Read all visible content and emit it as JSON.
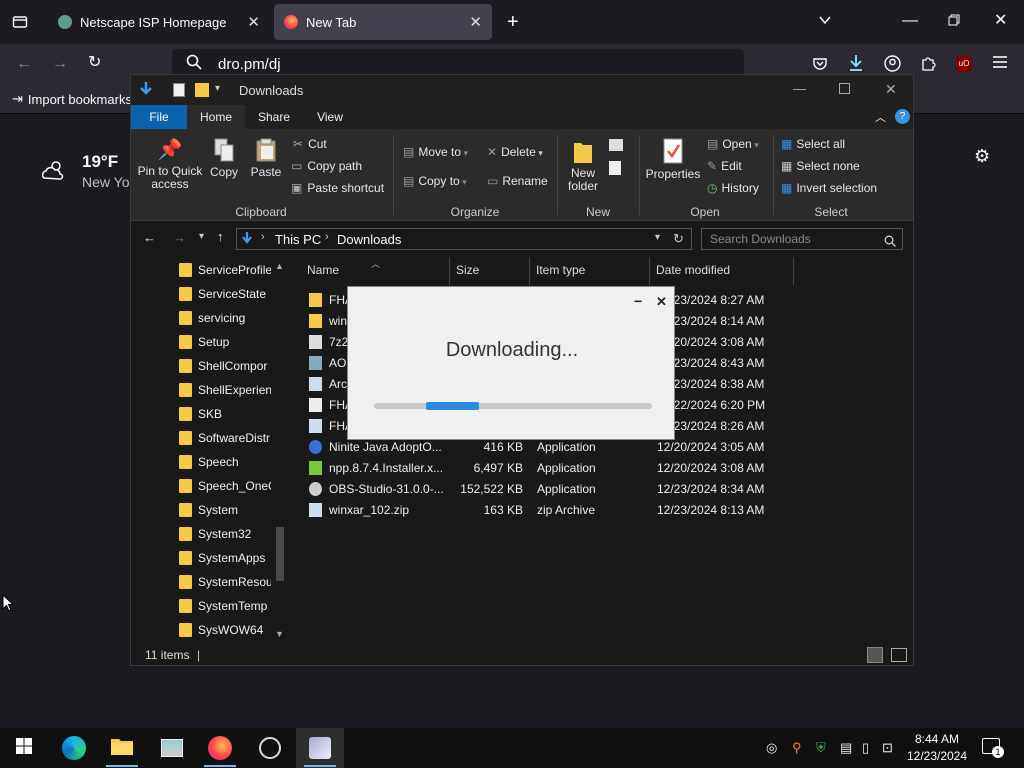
{
  "browser": {
    "tabs": [
      {
        "label": "Netscape ISP Homepage",
        "active": false
      },
      {
        "label": "New Tab",
        "active": true
      }
    ],
    "url": "dro.pm/dj",
    "bookmarks": {
      "import_label": "Import bookmarks"
    },
    "weather": {
      "temp": "19°F",
      "location": "New Yo"
    }
  },
  "explorer": {
    "title": "Downloads",
    "ribbon_tabs": [
      "File",
      "Home",
      "Share",
      "View"
    ],
    "clipboard": {
      "pin": "Pin to Quick access",
      "copy": "Copy",
      "paste": "Paste",
      "cut": "Cut",
      "copy_path": "Copy path",
      "paste_shortcut": "Paste shortcut",
      "group": "Clipboard"
    },
    "organize": {
      "move_to": "Move to",
      "copy_to": "Copy to",
      "delete": "Delete",
      "rename": "Rename",
      "group": "Organize"
    },
    "new": {
      "new_folder": "New folder",
      "group": "New"
    },
    "open": {
      "properties": "Properties",
      "open": "Open",
      "edit": "Edit",
      "history": "History",
      "group": "Open"
    },
    "select": {
      "select_all": "Select all",
      "select_none": "Select none",
      "invert": "Invert selection",
      "group": "Select"
    },
    "address": {
      "root": "This PC",
      "current": "Downloads"
    },
    "search_placeholder": "Search Downloads",
    "nav_items": [
      "ServiceProfile",
      "ServiceState",
      "servicing",
      "Setup",
      "ShellCompor",
      "ShellExperien",
      "SKB",
      "SoftwareDistr",
      "Speech",
      "Speech_OneC",
      "System",
      "System32",
      "SystemApps",
      "SystemResou",
      "SystemTemp",
      "SysWOW64"
    ],
    "columns": [
      "Name",
      "Size",
      "Item type",
      "Date modified"
    ],
    "files": [
      {
        "name": "FHA",
        "size": "",
        "type": "",
        "date": "12/23/2024 8:27 AM",
        "icon": "folder"
      },
      {
        "name": "win",
        "size": "",
        "type": "",
        "date": "12/23/2024 8:14 AM",
        "icon": "folder"
      },
      {
        "name": "7z2",
        "size": "",
        "type": "",
        "date": "12/20/2024 3:08 AM",
        "icon": "7z"
      },
      {
        "name": "AO",
        "size": "",
        "type": "",
        "date": "12/23/2024 8:43 AM",
        "icon": "app"
      },
      {
        "name": "Arc",
        "size": "",
        "type": "",
        "date": "12/23/2024 8:38 AM",
        "icon": "zip"
      },
      {
        "name": "FHA",
        "size": "",
        "type": "",
        "date": "12/22/2024 6:20 PM",
        "icon": "doc"
      },
      {
        "name": "FHA",
        "size": "",
        "type": "",
        "date": "12/23/2024 8:26 AM",
        "icon": "zip"
      },
      {
        "name": "Ninite Java AdoptO...",
        "size": "416 KB",
        "type": "Application",
        "date": "12/20/2024 3:05 AM",
        "icon": "ninite"
      },
      {
        "name": "npp.8.7.4.Installer.x...",
        "size": "6,497 KB",
        "type": "Application",
        "date": "12/20/2024 3:08 AM",
        "icon": "npp"
      },
      {
        "name": "OBS-Studio-31.0.0-...",
        "size": "152,522 KB",
        "type": "Application",
        "date": "12/23/2024 8:34 AM",
        "icon": "obs"
      },
      {
        "name": "winxar_102.zip",
        "size": "163 KB",
        "type": "zip Archive",
        "date": "12/23/2024 8:13 AM",
        "icon": "zip"
      }
    ],
    "status": "11 items"
  },
  "dialog": {
    "text": "Downloading...",
    "progress": 0.19
  },
  "taskbar": {
    "time": "8:44 AM",
    "date": "12/23/2024",
    "notifications": "1"
  },
  "colors": {
    "accent": "#0a64ad",
    "folder": "#f7c948",
    "progress": "#2c8be0"
  }
}
